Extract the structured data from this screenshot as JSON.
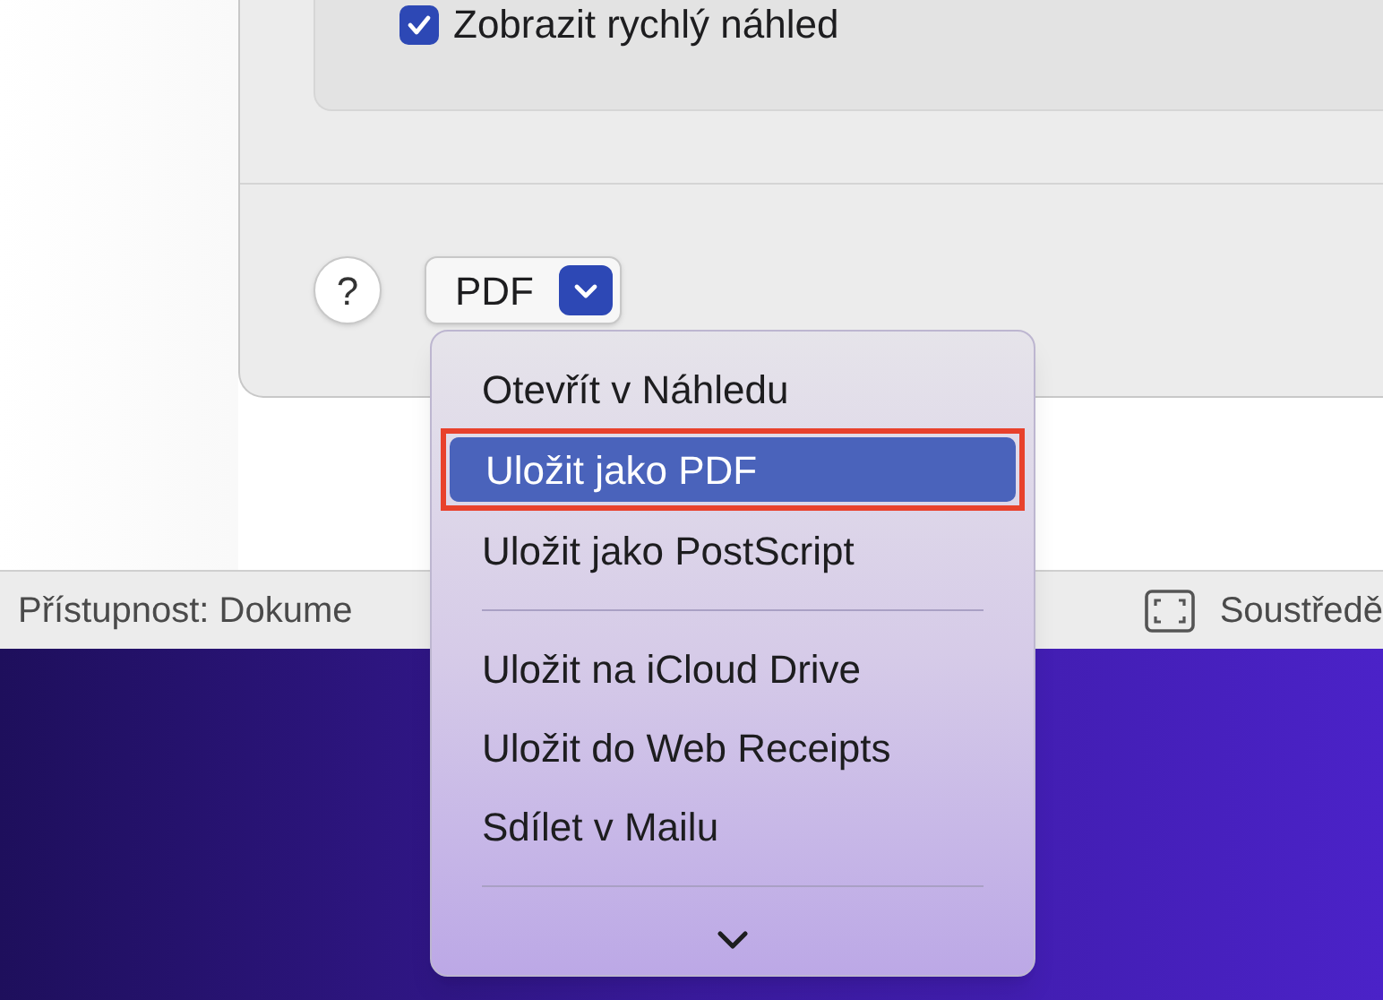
{
  "dialog": {
    "checkbox": {
      "label": "Zobrazit rychlý náhled",
      "checked": true
    },
    "help_button": {
      "label": "?"
    },
    "pdf_button": {
      "label": "PDF",
      "expanded": true
    }
  },
  "status_bar": {
    "accessibility": "Přístupnost: Dokume",
    "focus": "Soustředě"
  },
  "pdf_menu": {
    "items": [
      {
        "kind": "item",
        "label": "Otevřít v Náhledu",
        "selected": false
      },
      {
        "kind": "item",
        "label": "Uložit jako PDF",
        "selected": true
      },
      {
        "kind": "item",
        "label": "Uložit jako PostScript",
        "selected": false
      },
      {
        "kind": "separator"
      },
      {
        "kind": "item",
        "label": "Uložit na iCloud Drive",
        "selected": false
      },
      {
        "kind": "item",
        "label": "Uložit do Web Receipts",
        "selected": false
      },
      {
        "kind": "item",
        "label": "Sdílet v Mailu",
        "selected": false
      },
      {
        "kind": "separator"
      }
    ]
  }
}
